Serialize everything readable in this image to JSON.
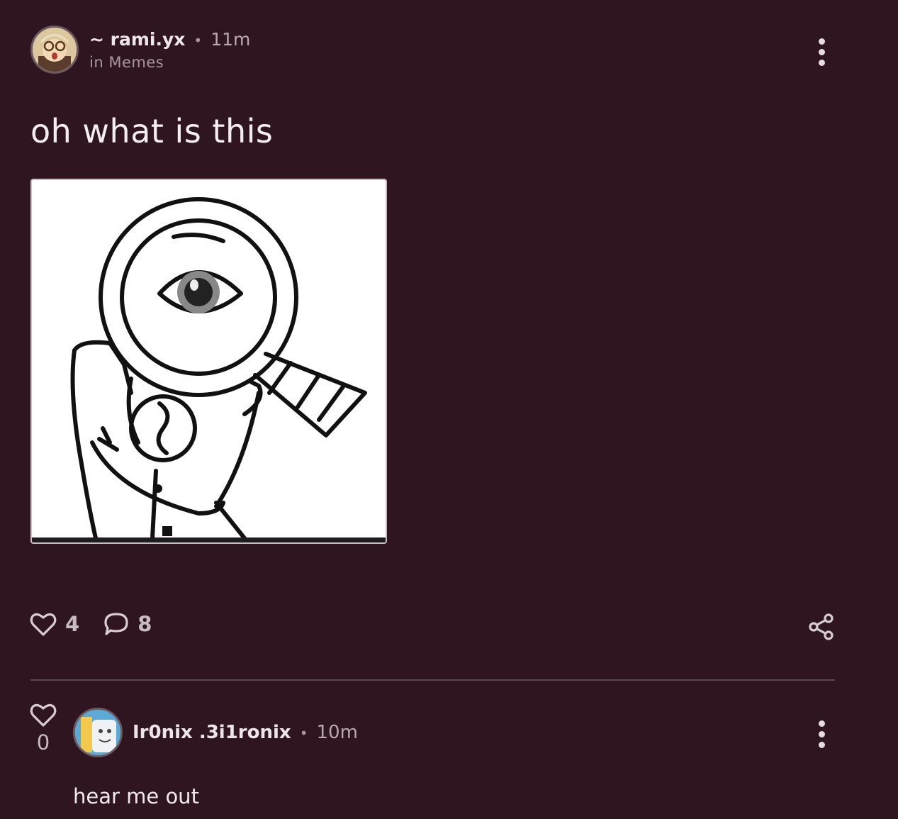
{
  "post": {
    "author": "~ rami.yx",
    "separator": "•",
    "time": "11m",
    "community": "in Memes",
    "title": "oh what is this",
    "likes": "4",
    "comments": "8"
  },
  "comment": {
    "author": "Ir0nix .3i1ronix",
    "separator": "•",
    "time": "10m",
    "votes": "0",
    "text": "hear me out"
  },
  "icons": {
    "like": "heart-outline-icon",
    "comment": "speech-bubble-icon",
    "share": "share-icon",
    "menu": "more-vertical-icon"
  },
  "colors": {
    "background": "#2e1520",
    "text": "#ece6ea",
    "muted": "#a9959f"
  }
}
